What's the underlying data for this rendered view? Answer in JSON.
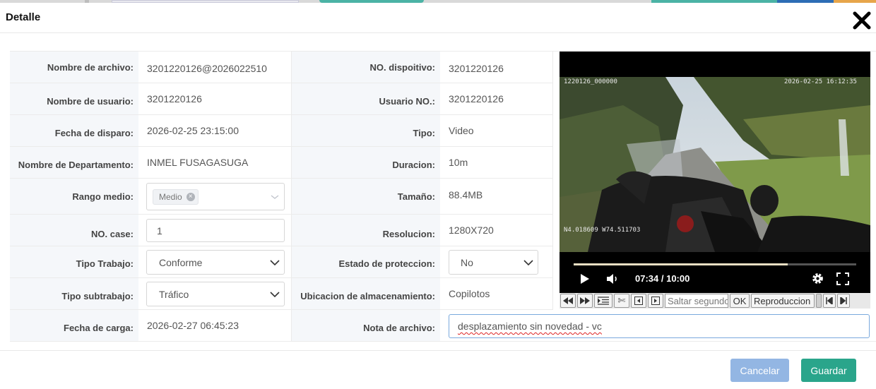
{
  "dialog": {
    "title": "Detalle"
  },
  "fields": {
    "nombre_archivo": {
      "label": "Nombre de archivo:",
      "value": "3201220126@2026022510"
    },
    "no_dispositivo": {
      "label": "NO. dispoitivo:",
      "value": "3201220126"
    },
    "nombre_usuario": {
      "label": "Nombre de usuario:",
      "value": "3201220126"
    },
    "usuario_no": {
      "label": "Usuario NO.:",
      "value": "3201220126"
    },
    "fecha_disparo": {
      "label": "Fecha de disparo:",
      "value": "2026-02-25 23:15:00"
    },
    "tipo": {
      "label": "Tipo:",
      "value": "Video"
    },
    "departamento": {
      "label": "Nombre de Departamento:",
      "value": "INMEL FUSAGASUGA"
    },
    "duracion": {
      "label": "Duracion:",
      "value": "10m"
    },
    "rango_medio": {
      "label": "Rango medio:",
      "tag": "Medio"
    },
    "tamano": {
      "label": "Tamaño:",
      "value": "88.4MB"
    },
    "no_case": {
      "label": "NO. case:",
      "value": "1"
    },
    "resolucion": {
      "label": "Resolucion:",
      "value": "1280X720"
    },
    "tipo_trabajo": {
      "label": "Tipo Trabajo:",
      "value": "Conforme"
    },
    "estado_proteccion": {
      "label": "Estado de proteccion:",
      "value": "No"
    },
    "tipo_subtrabajo": {
      "label": "Tipo subtrabajo:",
      "value": "Tráfico"
    },
    "ubicacion": {
      "label": "Ubicacion de almacenamiento:",
      "value": "Copilotos"
    },
    "fecha_carga": {
      "label": "Fecha de carga:",
      "value": "2026-02-27 06:45:23"
    },
    "nota": {
      "label": "Nota de archivo:",
      "value": "desplazamiento sin novedad - vc"
    }
  },
  "video": {
    "osd_left": "1220126_000000",
    "osd_right": "2026-02-25 16:12:35",
    "osd_coords": "N4.018609 W74.511703",
    "time": "07:34 / 10:00",
    "progress": 0.757
  },
  "toolbar": {
    "seek_placeholder": "Saltar segundos",
    "ok_label": "OK",
    "play_label": "Reproduccion"
  },
  "footer": {
    "cancel_label": "Cancelar",
    "save_label": "Guardar"
  },
  "colors": {
    "accent_save": "#2aa58b",
    "accent_cancel": "#93b6e3",
    "label_bg": "#f5f7fa"
  }
}
